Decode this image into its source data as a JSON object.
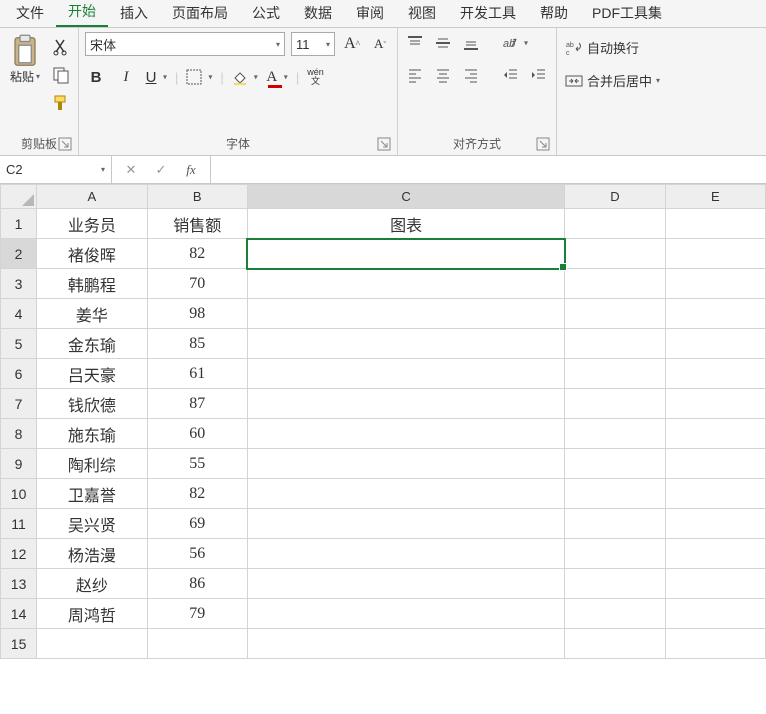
{
  "menu": {
    "items": [
      "文件",
      "开始",
      "插入",
      "页面布局",
      "公式",
      "数据",
      "审阅",
      "视图",
      "开发工具",
      "帮助",
      "PDF工具集"
    ],
    "active_index": 1
  },
  "ribbon": {
    "clipboard": {
      "paste_label": "粘贴",
      "group_label": "剪贴板"
    },
    "font": {
      "name": "宋体",
      "size": "11",
      "group_label": "字体",
      "bold": "B",
      "italic": "I",
      "underline": "U",
      "wen": "wén\n文"
    },
    "align": {
      "group_label": "对齐方式"
    },
    "wrap": {
      "wrap_label": "自动换行",
      "merge_label": "合并后居中"
    }
  },
  "formula_bar": {
    "cell_ref": "C2",
    "fx": "fx",
    "value": ""
  },
  "columns": [
    "A",
    "B",
    "C",
    "D",
    "E"
  ],
  "rows": [
    {
      "n": 1,
      "A": "业务员",
      "B": "销售额",
      "C": "图表",
      "D": "",
      "E": ""
    },
    {
      "n": 2,
      "A": "褚俊晖",
      "B": "82",
      "C": "",
      "D": "",
      "E": ""
    },
    {
      "n": 3,
      "A": "韩鹏程",
      "B": "70",
      "C": "",
      "D": "",
      "E": ""
    },
    {
      "n": 4,
      "A": "姜华",
      "B": "98",
      "C": "",
      "D": "",
      "E": ""
    },
    {
      "n": 5,
      "A": "金东瑜",
      "B": "85",
      "C": "",
      "D": "",
      "E": ""
    },
    {
      "n": 6,
      "A": "吕天豪",
      "B": "61",
      "C": "",
      "D": "",
      "E": ""
    },
    {
      "n": 7,
      "A": "钱欣德",
      "B": "87",
      "C": "",
      "D": "",
      "E": ""
    },
    {
      "n": 8,
      "A": "施东瑜",
      "B": "60",
      "C": "",
      "D": "",
      "E": ""
    },
    {
      "n": 9,
      "A": "陶利综",
      "B": "55",
      "C": "",
      "D": "",
      "E": ""
    },
    {
      "n": 10,
      "A": "卫嘉誉",
      "B": "82",
      "C": "",
      "D": "",
      "E": ""
    },
    {
      "n": 11,
      "A": "吴兴贤",
      "B": "69",
      "C": "",
      "D": "",
      "E": ""
    },
    {
      "n": 12,
      "A": "杨浩漫",
      "B": "56",
      "C": "",
      "D": "",
      "E": ""
    },
    {
      "n": 13,
      "A": "赵纱",
      "B": "86",
      "C": "",
      "D": "",
      "E": ""
    },
    {
      "n": 14,
      "A": "周鸿哲",
      "B": "79",
      "C": "",
      "D": "",
      "E": ""
    },
    {
      "n": 15,
      "A": "",
      "B": "",
      "C": "",
      "D": "",
      "E": ""
    }
  ],
  "selection": {
    "col": "C",
    "row": 2
  }
}
